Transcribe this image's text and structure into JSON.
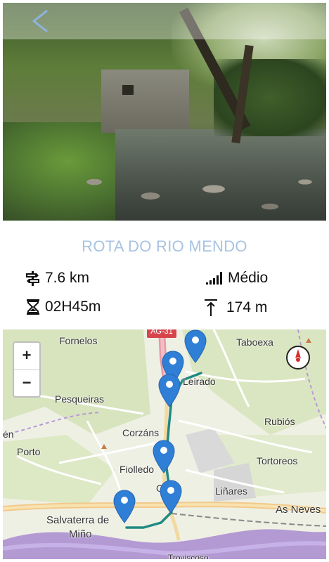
{
  "header": {
    "back_label": "<"
  },
  "route": {
    "title": "ROTA DO RIO MENDO",
    "distance": "7.6 km",
    "difficulty": "Médio",
    "duration": "02H45m",
    "elevation": "174 m"
  },
  "map": {
    "zoom_in": "+",
    "zoom_out": "−",
    "road_shield": "AG-31",
    "places": [
      "Fornelos",
      "Taboexa",
      "Leirado",
      "Pesqueiras",
      "Rubiós",
      "Corzáns",
      "Porto",
      "Tortoreos",
      "Fiolledo",
      "Oleir",
      "Liñares",
      "As Neves",
      "Salvaterra de",
      "Miño",
      "Troviscoso",
      "én"
    ],
    "accent_route_color": "#1f8a82",
    "marker_color": "#2f7fd6",
    "river_color": "#a98bd0"
  },
  "colors": {
    "title": "#a8c3e2"
  },
  "icons": [
    "back-arrow-icon",
    "signpost-icon",
    "signal-bars-icon",
    "hourglass-icon",
    "elevation-icon",
    "compass-icon",
    "map-marker-icon"
  ]
}
